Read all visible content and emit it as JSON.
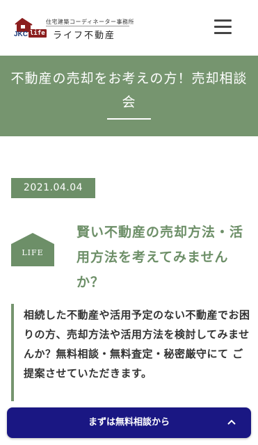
{
  "header": {
    "logo_sub": "住宅建築コーディネーター事務所",
    "logo_name": "ライフ不動産",
    "logo_jkc": "JKC",
    "logo_life": "life",
    "menu_icon": "hamburger-icon"
  },
  "hero": {
    "title": "不動産の売却をお考えの方！売却相談会"
  },
  "post": {
    "date": "2021.04.04",
    "icon_text": "LIFE",
    "heading": "賢い不動産の売却方法・活用方法を考えてみませんか？",
    "body": "相続した不動産や活用予定のない不動産でお困りの方、売却方法や活用方法を検討してみませんか？無料相談・無料査定・秘密厳守にて ご提案させていただきます。"
  },
  "cta": {
    "label": "まずは無料相談から",
    "icon": "chevron-up-icon"
  },
  "colors": {
    "accent_green": "#76956f",
    "cta_navy": "#1a1783",
    "logo_red": "#8b1e1e"
  }
}
